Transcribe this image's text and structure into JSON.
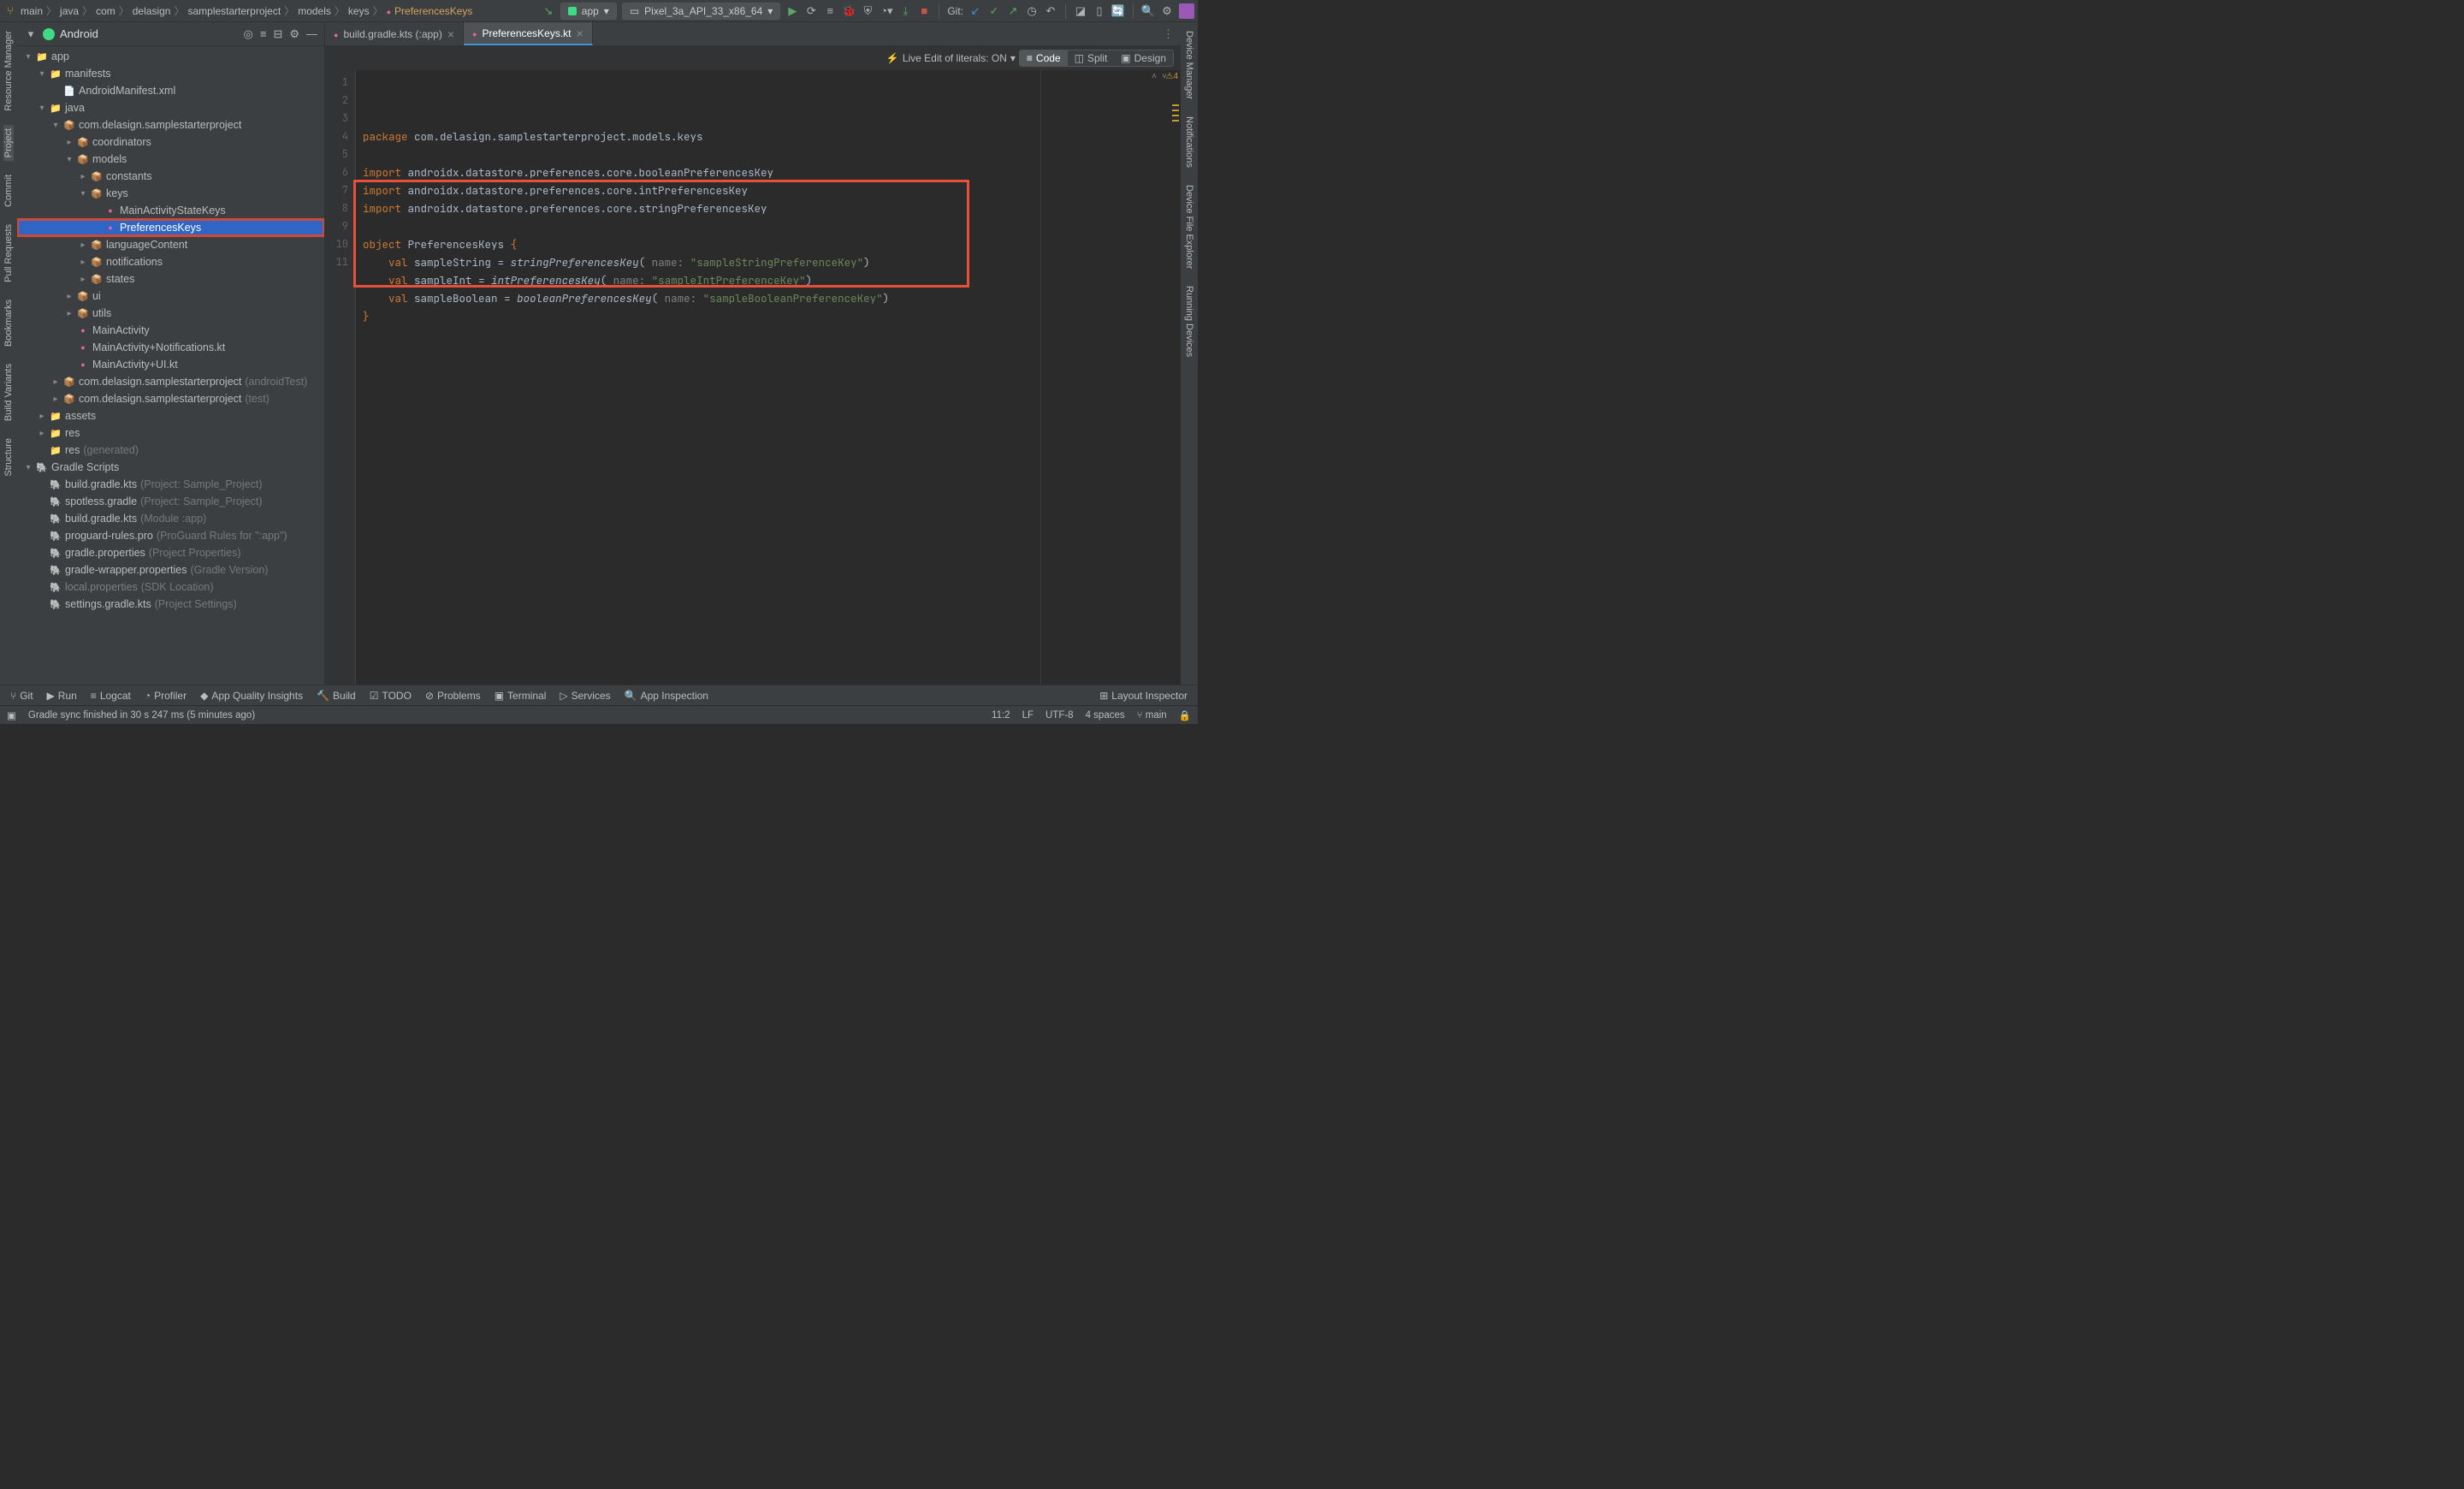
{
  "breadcrumb": {
    "branch": "main",
    "items": [
      "java",
      "com",
      "delasign",
      "samplestarterproject",
      "models",
      "keys"
    ],
    "file": "PreferencesKeys"
  },
  "toolbar": {
    "run_config": "app",
    "device": "Pixel_3a_API_33_x86_64",
    "git_label": "Git:"
  },
  "left_rail": [
    "Resource Manager",
    "Project",
    "Commit",
    "Pull Requests",
    "Bookmarks",
    "Build Variants",
    "Structure"
  ],
  "right_rail": [
    "Device Manager",
    "Notifications",
    "Device File Explorer",
    "Running Devices"
  ],
  "sidebar": {
    "title": "Android",
    "rows": [
      {
        "indent": 0,
        "arrow": "▾",
        "icon": "📁",
        "label": "app"
      },
      {
        "indent": 1,
        "arrow": "▾",
        "icon": "📁",
        "label": "manifests"
      },
      {
        "indent": 2,
        "arrow": "",
        "icon": "📄",
        "label": "AndroidManifest.xml",
        "cls": "xml"
      },
      {
        "indent": 1,
        "arrow": "▾",
        "icon": "📁",
        "label": "java"
      },
      {
        "indent": 2,
        "arrow": "▾",
        "icon": "📦",
        "label": "com.delasign.samplestarterproject"
      },
      {
        "indent": 3,
        "arrow": "▸",
        "icon": "📦",
        "label": "coordinators"
      },
      {
        "indent": 3,
        "arrow": "▾",
        "icon": "📦",
        "label": "models"
      },
      {
        "indent": 4,
        "arrow": "▸",
        "icon": "📦",
        "label": "constants"
      },
      {
        "indent": 4,
        "arrow": "▾",
        "icon": "📦",
        "label": "keys"
      },
      {
        "indent": 5,
        "arrow": "",
        "icon": "kt",
        "label": "MainActivityStateKeys"
      },
      {
        "indent": 5,
        "arrow": "",
        "icon": "kt",
        "label": "PreferencesKeys",
        "selected": true
      },
      {
        "indent": 4,
        "arrow": "▸",
        "icon": "📦",
        "label": "languageContent"
      },
      {
        "indent": 4,
        "arrow": "▸",
        "icon": "📦",
        "label": "notifications"
      },
      {
        "indent": 4,
        "arrow": "▸",
        "icon": "📦",
        "label": "states"
      },
      {
        "indent": 3,
        "arrow": "▸",
        "icon": "📦",
        "label": "ui"
      },
      {
        "indent": 3,
        "arrow": "▸",
        "icon": "📦",
        "label": "utils"
      },
      {
        "indent": 3,
        "arrow": "",
        "icon": "kt",
        "label": "MainActivity"
      },
      {
        "indent": 3,
        "arrow": "",
        "icon": "kt",
        "label": "MainActivity+Notifications.kt"
      },
      {
        "indent": 3,
        "arrow": "",
        "icon": "kt",
        "label": "MainActivity+UI.kt"
      },
      {
        "indent": 2,
        "arrow": "▸",
        "icon": "📦",
        "label": "com.delasign.samplestarterproject",
        "suffix": " (androidTest)"
      },
      {
        "indent": 2,
        "arrow": "▸",
        "icon": "📦",
        "label": "com.delasign.samplestarterproject",
        "suffix": " (test)"
      },
      {
        "indent": 1,
        "arrow": "▸",
        "icon": "📁",
        "label": "assets"
      },
      {
        "indent": 1,
        "arrow": "▸",
        "icon": "📁",
        "label": "res"
      },
      {
        "indent": 1,
        "arrow": "",
        "icon": "📁",
        "label": "res",
        "suffix": " (generated)"
      },
      {
        "indent": 0,
        "arrow": "▾",
        "icon": "🐘",
        "label": "Gradle Scripts"
      },
      {
        "indent": 1,
        "arrow": "",
        "icon": "g",
        "label": "build.gradle.kts",
        "suffix": " (Project: Sample_Project)"
      },
      {
        "indent": 1,
        "arrow": "",
        "icon": "g",
        "label": "spotless.gradle",
        "suffix": " (Project: Sample_Project)"
      },
      {
        "indent": 1,
        "arrow": "",
        "icon": "g",
        "label": "build.gradle.kts",
        "suffix": " (Module :app)"
      },
      {
        "indent": 1,
        "arrow": "",
        "icon": "g",
        "label": "proguard-rules.pro",
        "suffix": " (ProGuard Rules for \":app\")"
      },
      {
        "indent": 1,
        "arrow": "",
        "icon": "g",
        "label": "gradle.properties",
        "suffix": " (Project Properties)"
      },
      {
        "indent": 1,
        "arrow": "",
        "icon": "g",
        "label": "gradle-wrapper.properties",
        "suffix": " (Gradle Version)"
      },
      {
        "indent": 1,
        "arrow": "",
        "icon": "g",
        "label": "local.properties",
        "suffix": " (SDK Location)",
        "fade": true
      },
      {
        "indent": 1,
        "arrow": "",
        "icon": "g",
        "label": "settings.gradle.kts",
        "suffix": " (Project Settings)"
      }
    ]
  },
  "tabs": [
    {
      "label": "build.gradle.kts (:app)",
      "active": false
    },
    {
      "label": "PreferencesKeys.kt",
      "active": true
    }
  ],
  "editorbar": {
    "live_edit": "Live Edit of literals: ON",
    "views": [
      "Code",
      "Split",
      "Design"
    ]
  },
  "code": {
    "package_kw": "package",
    "package": "com.delasign.samplestarterproject.models.keys",
    "import_kw": "import",
    "imports": [
      "androidx.datastore.preferences.core.booleanPreferencesKey",
      "androidx.datastore.preferences.core.intPreferencesKey",
      "androidx.datastore.preferences.core.stringPreferencesKey"
    ],
    "object_kw": "object",
    "object_name": "PreferencesKeys",
    "val_kw": "val",
    "name_hint": "name:",
    "entries": [
      {
        "prop": "sampleString",
        "fn": "stringPreferencesKey",
        "key": "\"sampleStringPreferenceKey\""
      },
      {
        "prop": "sampleInt",
        "fn": "intPreferencesKey",
        "key": "\"sampleIntPreferenceKey\""
      },
      {
        "prop": "sampleBoolean",
        "fn": "booleanPreferencesKey",
        "key": "\"sampleBooleanPreferenceKey\""
      }
    ],
    "lines": [
      "1",
      "2",
      "3",
      "4",
      "5",
      "6",
      "7",
      "8",
      "9",
      "10",
      "11"
    ],
    "warn_count": "4"
  },
  "bottom_tools": [
    "Git",
    "Run",
    "Logcat",
    "Profiler",
    "App Quality Insights",
    "Build",
    "TODO",
    "Problems",
    "Terminal",
    "Services",
    "App Inspection"
  ],
  "layout_inspector": "Layout Inspector",
  "status": {
    "msg": "Gradle sync finished in 30 s 247 ms (5 minutes ago)",
    "cursor": "11:2",
    "line_sep": "LF",
    "encoding": "UTF-8",
    "indent": "4 spaces",
    "branch": "main",
    "lock": "🔒"
  }
}
